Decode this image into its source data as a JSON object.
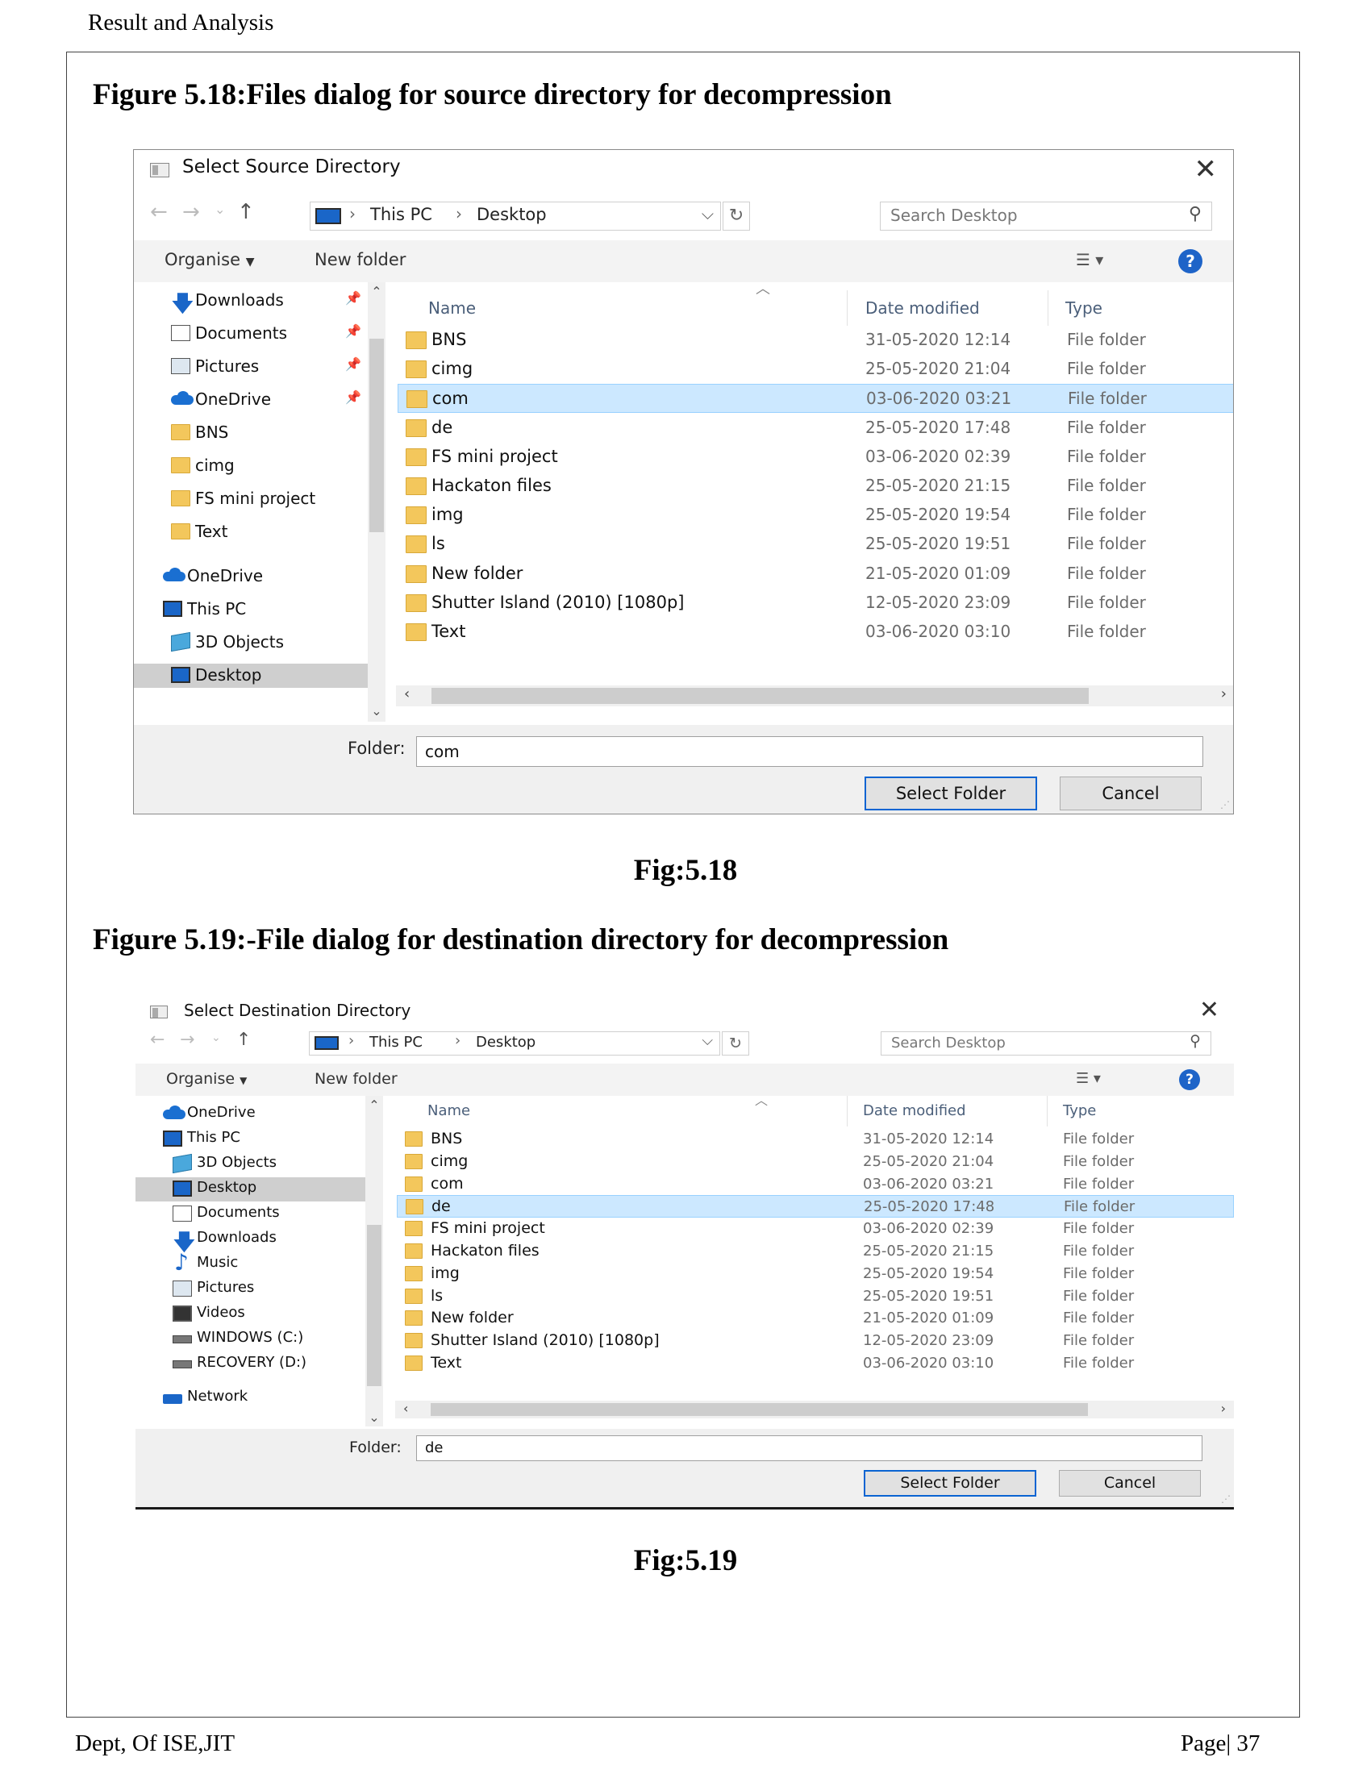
{
  "page": {
    "header": "Result and Analysis",
    "footer_left": "Dept, Of ISE,JIT",
    "footer_right": "Page| 37"
  },
  "figure1": {
    "heading": "Figure 5.18:Files dialog for source directory for decompression",
    "caption": "Fig:5.18",
    "dialog": {
      "title": "Select Source Directory",
      "address": [
        "This PC",
        "Desktop"
      ],
      "search_placeholder": "Search Desktop",
      "toolbar": {
        "organise": "Organise",
        "new_folder": "New folder"
      },
      "nav_items": [
        {
          "label": "Downloads",
          "icon": "downloads-icon",
          "pinned": true,
          "indent": 1
        },
        {
          "label": "Documents",
          "icon": "documents-icon",
          "pinned": true,
          "indent": 1
        },
        {
          "label": "Pictures",
          "icon": "pictures-icon",
          "pinned": true,
          "indent": 1
        },
        {
          "label": "OneDrive",
          "icon": "onedrive-icon",
          "pinned": true,
          "indent": 1
        },
        {
          "label": "BNS",
          "icon": "folder-icon",
          "indent": 1
        },
        {
          "label": "cimg",
          "icon": "folder-icon",
          "indent": 1
        },
        {
          "label": "FS mini project",
          "icon": "folder-icon",
          "indent": 1
        },
        {
          "label": "Text",
          "icon": "folder-icon",
          "indent": 1
        },
        {
          "label": "OneDrive",
          "icon": "onedrive-icon",
          "indent": 0
        },
        {
          "label": "This PC",
          "icon": "this-pc-icon",
          "indent": 0
        },
        {
          "label": "3D Objects",
          "icon": "3d-objects-icon",
          "indent": 1
        },
        {
          "label": "Desktop",
          "icon": "desktop-icon",
          "indent": 1,
          "selected": true
        }
      ],
      "columns": {
        "name": "Name",
        "date": "Date modified",
        "type": "Type"
      },
      "files": [
        {
          "name": "BNS",
          "date": "31-05-2020 12:14",
          "type": "File folder"
        },
        {
          "name": "cimg",
          "date": "25-05-2020 21:04",
          "type": "File folder"
        },
        {
          "name": "com",
          "date": "03-06-2020 03:21",
          "type": "File folder",
          "selected": true
        },
        {
          "name": "de",
          "date": "25-05-2020 17:48",
          "type": "File folder"
        },
        {
          "name": "FS mini project",
          "date": "03-06-2020 02:39",
          "type": "File folder"
        },
        {
          "name": "Hackaton files",
          "date": "25-05-2020 21:15",
          "type": "File folder"
        },
        {
          "name": "img",
          "date": "25-05-2020 19:54",
          "type": "File folder"
        },
        {
          "name": "ls",
          "date": "25-05-2020 19:51",
          "type": "File folder"
        },
        {
          "name": "New folder",
          "date": "21-05-2020 01:09",
          "type": "File folder"
        },
        {
          "name": "Shutter Island (2010) [1080p]",
          "date": "12-05-2020 23:09",
          "type": "File folder"
        },
        {
          "name": "Text",
          "date": "03-06-2020 03:10",
          "type": "File folder"
        }
      ],
      "folder_label": "Folder:",
      "folder_value": "com",
      "select_button": "Select Folder",
      "cancel_button": "Cancel"
    }
  },
  "figure2": {
    "heading": "Figure 5.19:-File dialog for destination directory for decompression",
    "caption": "Fig:5.19",
    "dialog": {
      "title": "Select Destination Directory",
      "address": [
        "This PC",
        "Desktop"
      ],
      "search_placeholder": "Search Desktop",
      "toolbar": {
        "organise": "Organise",
        "new_folder": "New folder"
      },
      "nav_items": [
        {
          "label": "OneDrive",
          "icon": "onedrive-icon",
          "indent": 0
        },
        {
          "label": "This PC",
          "icon": "this-pc-icon",
          "indent": 0
        },
        {
          "label": "3D Objects",
          "icon": "3d-objects-icon",
          "indent": 1
        },
        {
          "label": "Desktop",
          "icon": "desktop-icon",
          "indent": 1,
          "selected": true
        },
        {
          "label": "Documents",
          "icon": "documents-icon",
          "indent": 1
        },
        {
          "label": "Downloads",
          "icon": "downloads-icon",
          "indent": 1
        },
        {
          "label": "Music",
          "icon": "music-icon",
          "indent": 1
        },
        {
          "label": "Pictures",
          "icon": "pictures-icon",
          "indent": 1
        },
        {
          "label": "Videos",
          "icon": "videos-icon",
          "indent": 1
        },
        {
          "label": "WINDOWS (C:)",
          "icon": "drive-icon",
          "indent": 1
        },
        {
          "label": "RECOVERY (D:)",
          "icon": "drive-icon",
          "indent": 1
        },
        {
          "label": "Network",
          "icon": "network-icon",
          "indent": 0
        }
      ],
      "columns": {
        "name": "Name",
        "date": "Date modified",
        "type": "Type"
      },
      "files": [
        {
          "name": "BNS",
          "date": "31-05-2020 12:14",
          "type": "File folder"
        },
        {
          "name": "cimg",
          "date": "25-05-2020 21:04",
          "type": "File folder"
        },
        {
          "name": "com",
          "date": "03-06-2020 03:21",
          "type": "File folder"
        },
        {
          "name": "de",
          "date": "25-05-2020 17:48",
          "type": "File folder",
          "selected": true
        },
        {
          "name": "FS mini project",
          "date": "03-06-2020 02:39",
          "type": "File folder"
        },
        {
          "name": "Hackaton files",
          "date": "25-05-2020 21:15",
          "type": "File folder"
        },
        {
          "name": "img",
          "date": "25-05-2020 19:54",
          "type": "File folder"
        },
        {
          "name": "ls",
          "date": "25-05-2020 19:51",
          "type": "File folder"
        },
        {
          "name": "New folder",
          "date": "21-05-2020 01:09",
          "type": "File folder"
        },
        {
          "name": "Shutter Island (2010) [1080p]",
          "date": "12-05-2020 23:09",
          "type": "File folder"
        },
        {
          "name": "Text",
          "date": "03-06-2020 03:10",
          "type": "File folder"
        }
      ],
      "folder_label": "Folder:",
      "folder_value": "de",
      "select_button": "Select Folder",
      "cancel_button": "Cancel"
    }
  }
}
